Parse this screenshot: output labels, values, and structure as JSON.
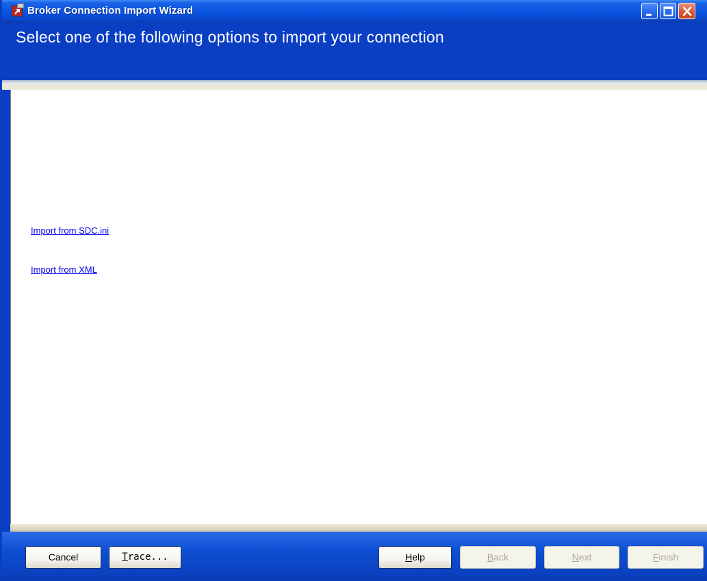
{
  "window": {
    "title": "Broker Connection Import Wizard"
  },
  "header": {
    "text": "Select one of the following options to import your connection"
  },
  "options": {
    "sdc": "Import from SDC.ini",
    "xml": "Import from XML"
  },
  "footer": {
    "cancel": {
      "label": "Cancel",
      "enabled": true
    },
    "trace": {
      "mnemonic": "T",
      "rest": "race...",
      "enabled": true
    },
    "help": {
      "mnemonic": "H",
      "rest": "elp",
      "enabled": true
    },
    "back": {
      "mnemonic": "B",
      "rest": "ack",
      "enabled": false
    },
    "next": {
      "mnemonic": "N",
      "rest": "ext",
      "enabled": false
    },
    "finish": {
      "mnemonic": "F",
      "rest": "inish",
      "enabled": false
    }
  },
  "colors": {
    "titlebar": "#0a55e0",
    "header_bg": "#0a3fc4",
    "link": "#0000ee",
    "close_button": "#d9582f",
    "disabled_text": "#aca899"
  },
  "icons": {
    "app": "import-arrow-icon",
    "minimize": "minimize-icon",
    "maximize": "maximize-icon",
    "close": "close-icon"
  }
}
